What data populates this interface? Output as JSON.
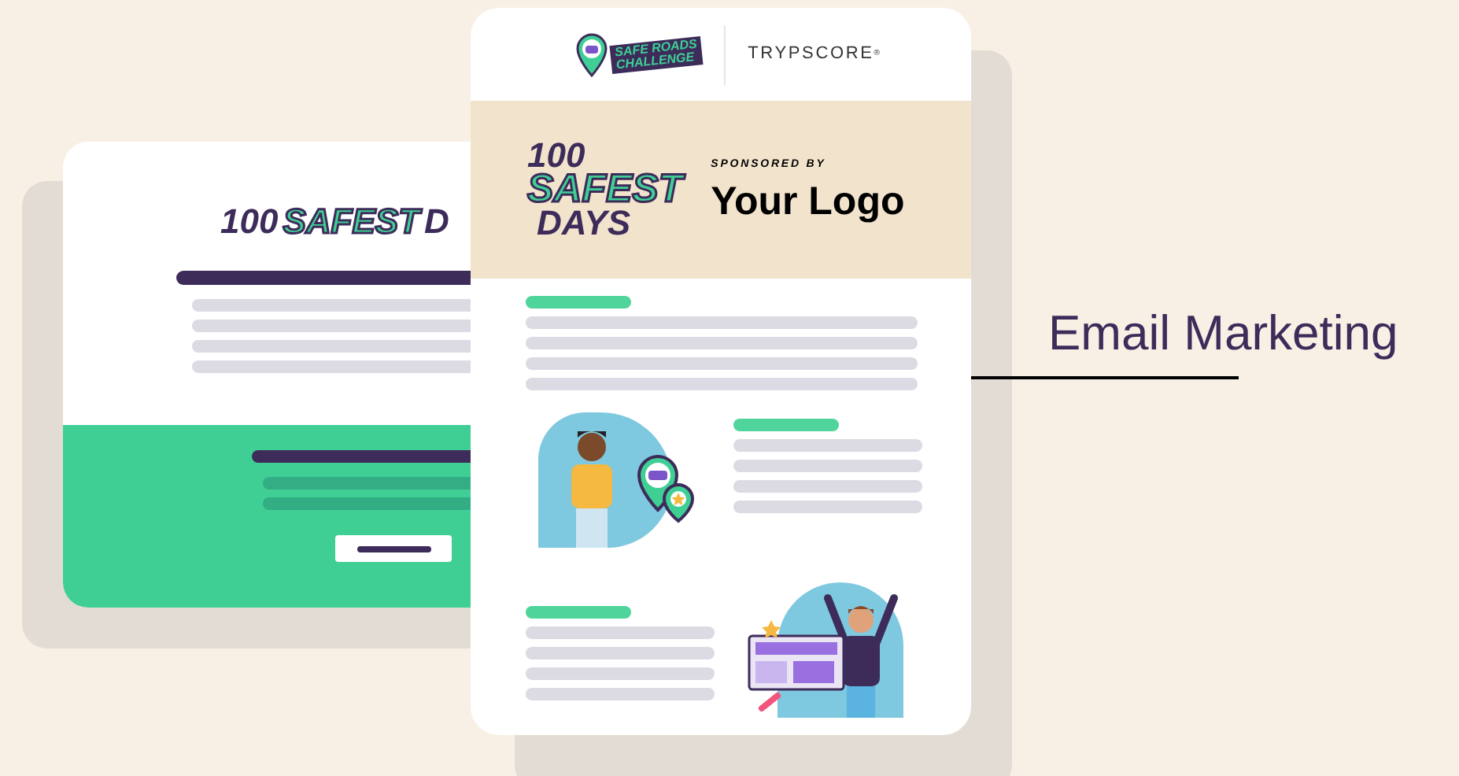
{
  "back_card": {
    "logo": {
      "number": "100",
      "highlight": "SAFEST",
      "tail": "D"
    }
  },
  "front_card": {
    "header": {
      "challenge_logo": [
        "SAFE ROADS",
        "CHALLENGE"
      ],
      "brand": "TRYPSCORE",
      "brand_mark": "®"
    },
    "banner": {
      "logo": {
        "number": "100",
        "highlight": "SAFEST",
        "tail": "DAYS"
      },
      "sponsored_label": "SPONSORED BY",
      "sponsor": "Your Logo"
    }
  },
  "caption": "Email Marketing"
}
